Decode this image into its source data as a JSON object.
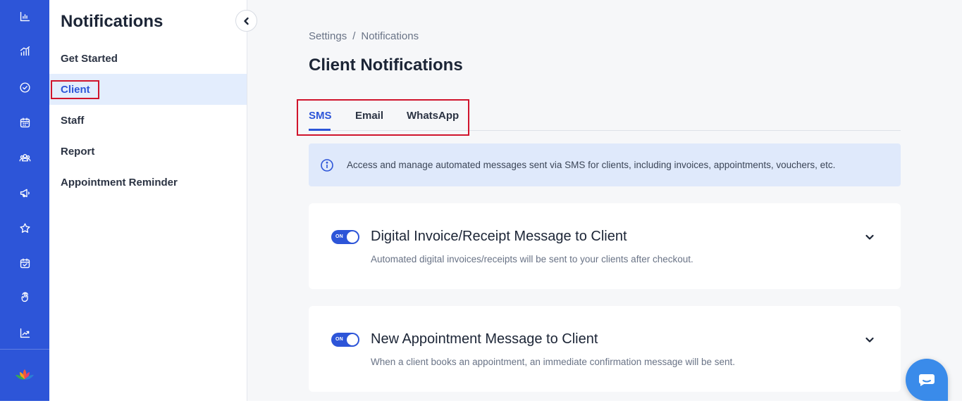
{
  "rail": {
    "items": [
      {
        "icon": "bar-chart-icon"
      },
      {
        "icon": "growth-chart-icon"
      },
      {
        "icon": "check-circle-icon"
      },
      {
        "icon": "calendar-icon"
      },
      {
        "icon": "users-group-icon"
      },
      {
        "icon": "megaphone-icon"
      },
      {
        "icon": "star-icon"
      },
      {
        "icon": "calendar-check-icon"
      },
      {
        "icon": "touch-icon"
      },
      {
        "icon": "trend-up-icon"
      }
    ],
    "logo": "lotus-logo"
  },
  "subnav": {
    "title": "Notifications",
    "items": [
      {
        "label": "Get Started"
      },
      {
        "label": "Client",
        "active": true
      },
      {
        "label": "Staff"
      },
      {
        "label": "Report"
      },
      {
        "label": "Appointment Reminder"
      }
    ]
  },
  "main": {
    "breadcrumb": {
      "root": "Settings",
      "separator": "/",
      "current": "Notifications"
    },
    "title": "Client Notifications",
    "tabs": [
      {
        "label": "SMS",
        "active": true
      },
      {
        "label": "Email"
      },
      {
        "label": "WhatsApp"
      }
    ],
    "info": "Access and manage automated messages sent via SMS for clients, including invoices, appointments, vouchers, etc.",
    "cards": [
      {
        "toggle_label": "ON",
        "title": "Digital Invoice/Receipt Message to Client",
        "description": "Automated digital invoices/receipts will be sent to your clients after checkout."
      },
      {
        "toggle_label": "ON",
        "title": "New Appointment Message to Client",
        "description": "When a client books an appointment, an immediate confirmation message will be sent."
      }
    ]
  },
  "colors": {
    "primary": "#2d55d8",
    "highlight_outline": "#d0142c",
    "chat": "#3a8bea"
  }
}
